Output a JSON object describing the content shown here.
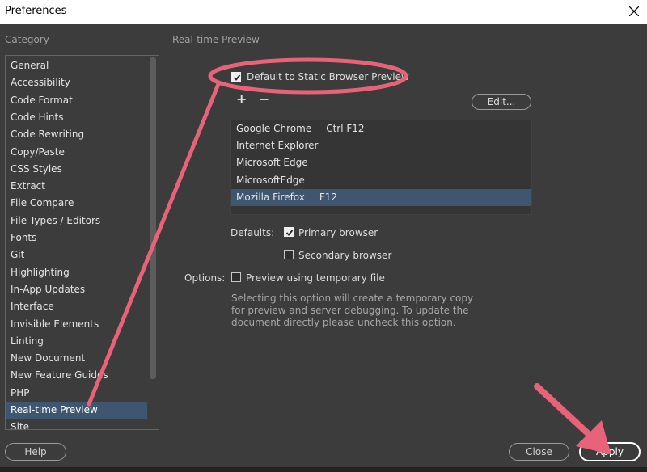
{
  "window": {
    "title": "Preferences"
  },
  "category_header": "Category",
  "panel_header": "Real-time Preview",
  "categories": [
    "General",
    "Accessibility",
    "Code Format",
    "Code Hints",
    "Code Rewriting",
    "Copy/Paste",
    "CSS Styles",
    "Extract",
    "File Compare",
    "File Types / Editors",
    "Fonts",
    "Git",
    "Highlighting",
    "In-App Updates",
    "Interface",
    "Invisible Elements",
    "Linting",
    "New Document",
    "New Feature Guides",
    "PHP",
    "Real-time Preview",
    "Site"
  ],
  "selected_category": "Real-time Preview",
  "static_preview": {
    "label": "Default to Static Browser Preview",
    "checked": true
  },
  "add_label": "+",
  "remove_label": "−",
  "edit_label": "Edit...",
  "browsers": [
    {
      "name": "Google Chrome",
      "shortcut": "Ctrl F12"
    },
    {
      "name": "Internet Explorer",
      "shortcut": ""
    },
    {
      "name": "Microsoft Edge",
      "shortcut": ""
    },
    {
      "name": "MicrosoftEdge",
      "shortcut": ""
    },
    {
      "name": "Mozilla Firefox",
      "shortcut": "F12"
    }
  ],
  "selected_browser": "Mozilla Firefox",
  "defaults": {
    "label": "Defaults:",
    "primary": {
      "label": "Primary browser",
      "checked": true
    },
    "secondary": {
      "label": "Secondary browser",
      "checked": false
    }
  },
  "options": {
    "label": "Options:",
    "temp_file": {
      "label": "Preview using temporary file",
      "checked": false
    },
    "description": "Selecting this option will create a temporary copy for preview and server debugging. To update the document directly please uncheck this option."
  },
  "buttons": {
    "help": "Help",
    "close": "Close",
    "apply": "Apply"
  },
  "colors": {
    "annotation": "#e8637a",
    "background": "#3c3c3c",
    "selection": "#3f5670"
  }
}
